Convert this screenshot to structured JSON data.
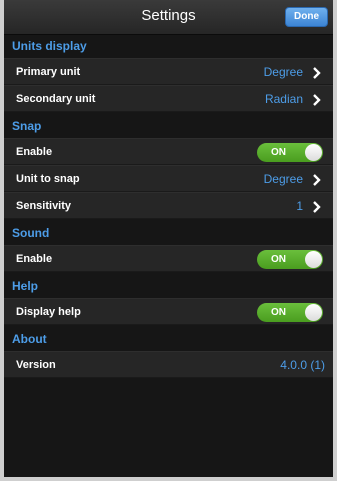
{
  "nav": {
    "title": "Settings",
    "done_label": "Done"
  },
  "units_display": {
    "header": "Units display",
    "primary_unit": {
      "label": "Primary unit",
      "value": "Degree"
    },
    "secondary_unit": {
      "label": "Secondary unit",
      "value": "Radian"
    }
  },
  "snap": {
    "header": "Snap",
    "enable": {
      "label": "Enable",
      "toggle": "ON"
    },
    "unit_to_snap": {
      "label": "Unit to snap",
      "value": "Degree"
    },
    "sensitivity": {
      "label": "Sensitivity",
      "value": "1"
    }
  },
  "sound": {
    "header": "Sound",
    "enable": {
      "label": "Enable",
      "toggle": "ON"
    }
  },
  "help": {
    "header": "Help",
    "display_help": {
      "label": "Display help",
      "toggle": "ON"
    }
  },
  "about": {
    "header": "About",
    "version": {
      "label": "Version",
      "value": "4.0.0 (1)"
    }
  },
  "colors": {
    "accent": "#4d9de8",
    "toggle_on": "#5aae2c",
    "background": "#161616",
    "row_background": "#262626"
  }
}
